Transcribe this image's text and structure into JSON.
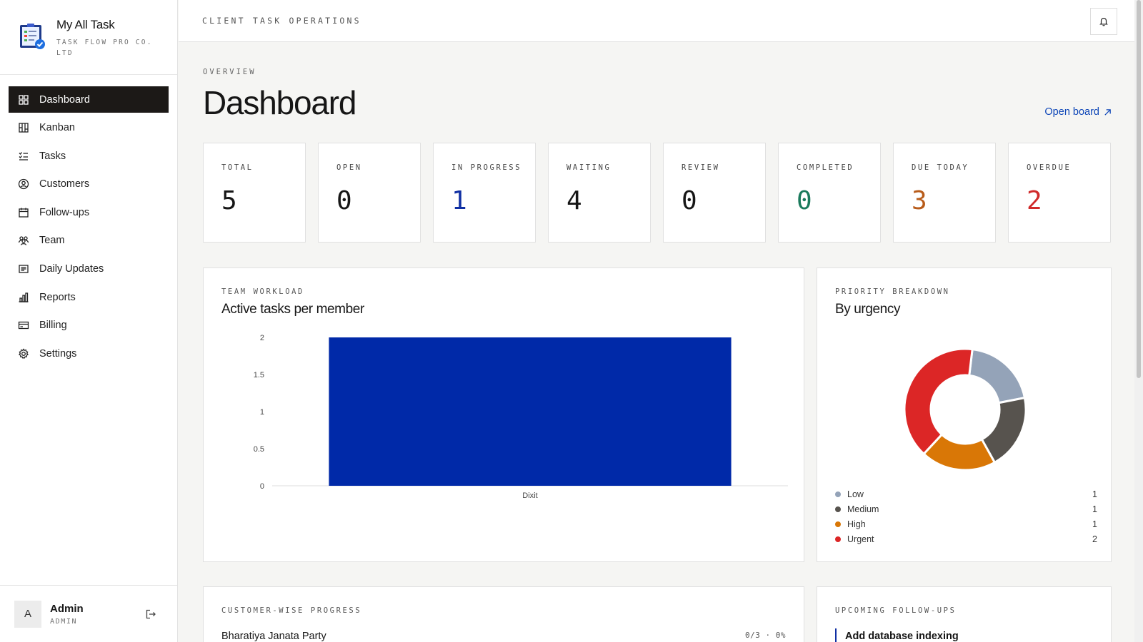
{
  "brand": {
    "name": "My All Task",
    "company": "TASK FLOW PRO CO. LTD"
  },
  "nav": [
    {
      "label": "Dashboard",
      "icon": "grid-icon",
      "active": true
    },
    {
      "label": "Kanban",
      "icon": "kanban-icon"
    },
    {
      "label": "Tasks",
      "icon": "checklist-icon"
    },
    {
      "label": "Customers",
      "icon": "user-circle-icon"
    },
    {
      "label": "Follow-ups",
      "icon": "calendar-icon"
    },
    {
      "label": "Team",
      "icon": "team-icon"
    },
    {
      "label": "Daily Updates",
      "icon": "newspaper-icon"
    },
    {
      "label": "Reports",
      "icon": "bar-chart-icon"
    },
    {
      "label": "Billing",
      "icon": "credit-card-icon"
    },
    {
      "label": "Settings",
      "icon": "gear-icon"
    }
  ],
  "user": {
    "initial": "A",
    "name": "Admin",
    "role": "ADMIN"
  },
  "topbar": {
    "title": "CLIENT TASK OPERATIONS"
  },
  "page": {
    "eyebrow": "OVERVIEW",
    "title": "Dashboard",
    "open_board": "Open board"
  },
  "stats": [
    {
      "label": "TOTAL",
      "value": "5",
      "color": "#161616"
    },
    {
      "label": "OPEN",
      "value": "0",
      "color": "#161616"
    },
    {
      "label": "IN PROGRESS",
      "value": "1",
      "color": "#0f2fa3"
    },
    {
      "label": "WAITING",
      "value": "4",
      "color": "#161616"
    },
    {
      "label": "REVIEW",
      "value": "0",
      "color": "#161616"
    },
    {
      "label": "COMPLETED",
      "value": "0",
      "color": "#1a7a5c"
    },
    {
      "label": "DUE TODAY",
      "value": "3",
      "color": "#b85c1a"
    },
    {
      "label": "OVERDUE",
      "value": "2",
      "color": "#d02a2a"
    }
  ],
  "workload": {
    "eyebrow": "TEAM WORKLOAD",
    "title": "Active tasks per member"
  },
  "priority": {
    "eyebrow": "PRIORITY BREAKDOWN",
    "title": "By urgency"
  },
  "customer_progress": {
    "eyebrow": "CUSTOMER-WISE PROGRESS",
    "name": "Bharatiya Janata Party",
    "stat": "0/3 · 0%"
  },
  "followups": {
    "eyebrow": "UPCOMING FOLLOW-UPS",
    "item": "Add database indexing"
  },
  "chart_data": [
    {
      "type": "bar",
      "categories": [
        "Dixit"
      ],
      "values": [
        2
      ],
      "title": "Active tasks per member",
      "xlabel": "",
      "ylabel": "",
      "ylim": [
        0,
        2
      ],
      "yticks": [
        "0",
        "0.5",
        "1",
        "1.5",
        "2"
      ],
      "color": "#0029a8",
      "grid": false
    },
    {
      "type": "pie",
      "title": "By urgency",
      "categories": [
        "Low",
        "Medium",
        "High",
        "Urgent"
      ],
      "values": [
        1,
        1,
        1,
        2
      ],
      "counts": [
        "1",
        "1",
        "1",
        "2"
      ],
      "colors": [
        "#94a3b8",
        "#57534e",
        "#d97706",
        "#dc2626"
      ],
      "donut": true,
      "legend": "bottom"
    }
  ]
}
